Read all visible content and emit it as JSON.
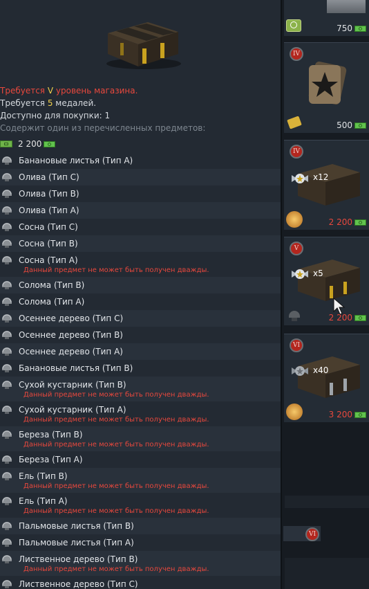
{
  "tooltip": {
    "req_prefix": "Требуется ",
    "req_level": "V",
    "req_suffix": " уровень магазина.",
    "medals_prefix": "Требуется ",
    "medals_count": "5",
    "medals_suffix": " медалей.",
    "available": "Доступно для покупки: 1",
    "contains": "Содержит один из перечисленных предметов:",
    "price": "2 200",
    "items": [
      {
        "name": "Банановые листья (Тип A)",
        "warning": ""
      },
      {
        "name": "Олива (Тип C)",
        "warning": ""
      },
      {
        "name": "Олива (Тип B)",
        "warning": ""
      },
      {
        "name": "Олива (Тип A)",
        "warning": ""
      },
      {
        "name": "Сосна (Тип C)",
        "warning": ""
      },
      {
        "name": "Сосна (Тип B)",
        "warning": ""
      },
      {
        "name": "Сосна (Тип A)",
        "warning": "Данный предмет не может быть получен дважды."
      },
      {
        "name": "Солома (Тип B)",
        "warning": ""
      },
      {
        "name": "Солома (Тип A)",
        "warning": ""
      },
      {
        "name": "Осеннее дерево (Тип C)",
        "warning": ""
      },
      {
        "name": "Осеннее дерево (Тип B)",
        "warning": ""
      },
      {
        "name": "Осеннее дерево (Тип A)",
        "warning": ""
      },
      {
        "name": "Банановые листья (Тип B)",
        "warning": ""
      },
      {
        "name": "Сухой кустарник (Тип B)",
        "warning": "Данный предмет не может быть получен дважды."
      },
      {
        "name": "Сухой кустарник (Тип A)",
        "warning": "Данный предмет не может быть получен дважды."
      },
      {
        "name": "Береза (Тип B)",
        "warning": "Данный предмет не может быть получен дважды."
      },
      {
        "name": "Береза (Тип A)",
        "warning": ""
      },
      {
        "name": "Ель (Тип B)",
        "warning": "Данный предмет не может быть получен дважды."
      },
      {
        "name": "Ель (Тип A)",
        "warning": "Данный предмет не может быть получен дважды."
      },
      {
        "name": "Пальмовые листья (Тип B)",
        "warning": ""
      },
      {
        "name": "Пальмовые листья (Тип A)",
        "warning": ""
      },
      {
        "name": "Лиственное дерево (Тип B)",
        "warning": "Данный предмет не может быть получен дважды."
      },
      {
        "name": "Лиственное дерево (Тип C)",
        "warning": ""
      }
    ]
  },
  "side": {
    "cards": [
      {
        "rank": "",
        "price": "750",
        "price_color": "white",
        "multiplier": ""
      },
      {
        "rank": "IV",
        "price": "500",
        "price_color": "white",
        "multiplier": ""
      },
      {
        "rank": "IV",
        "price": "2 200",
        "price_color": "red",
        "multiplier": "x12"
      },
      {
        "rank": "V",
        "price": "2 200",
        "price_color": "red",
        "multiplier": "x5"
      },
      {
        "rank": "VI",
        "price": "3 200",
        "price_color": "red",
        "multiplier": "x40"
      }
    ],
    "bottom_rank": "VI"
  },
  "colors": {
    "warning": "#e8483d",
    "highlight": "#f0d04c",
    "currency": "#62c24e"
  }
}
